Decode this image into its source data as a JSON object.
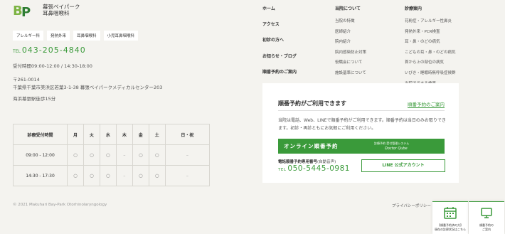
{
  "logo": {
    "mark_b": "B",
    "mark_p": "P",
    "line1": "幕張ベイパーク",
    "line2": "耳鼻咽喉科"
  },
  "chips": [
    "アレルギー科",
    "発熱外来",
    "耳鼻咽喉科",
    "小児耳鼻咽喉科"
  ],
  "contact": {
    "tel_label": "TEL",
    "tel": "043-205-4840",
    "hours": "受付時間09:00-12:00 / 14:30-18:00",
    "postal": "〒261-0014",
    "address": "千葉県千葉市美浜区若葉3-1-38 幕張ベイパークメディカルセンター203",
    "station": "海浜幕張駅徒歩15分"
  },
  "schedule": {
    "header": [
      "診療受付時間",
      "月",
      "火",
      "水",
      "木",
      "金",
      "土",
      "日・祝"
    ],
    "rows": [
      {
        "time": "09:00 - 12:00",
        "cells": [
          "○",
          "○",
          "○",
          "–",
          "○",
          "○",
          "–"
        ]
      },
      {
        "time": "14:30 - 17:30",
        "cells": [
          "○",
          "○",
          "○",
          "–",
          "○",
          "○",
          "–"
        ]
      }
    ]
  },
  "nav": {
    "main": [
      "ホーム",
      "アクセス",
      "初診の方へ",
      "お知らせ・ブログ",
      "順番予約のご案内"
    ],
    "about": {
      "title": "当院について",
      "items": [
        "当院の特徴",
        "医師紹介",
        "院内紹介",
        "院内感染防止対策",
        "役職会について",
        "施設基準について"
      ]
    },
    "medical": {
      "title": "診療案内",
      "items": [
        "花粉症・アレルギー性鼻炎",
        "発熱外来・PCR検査",
        "耳・鼻・のどの病気",
        "こどもの耳・鼻・のどの病気",
        "首から上の部位の病気",
        "いびき・睡眠時無呼吸症候群",
        "当院でできる検査"
      ]
    }
  },
  "reservation": {
    "title": "順番予約がご利用できます",
    "link": "順番予約のご案内",
    "desc": "当院は電話、Web、LINEで順番予約がご利用できます。順番予約は当日のみお取りできます。初診・再診ともにお気軽にご利用ください。",
    "banner_main": "オンライン順番予約",
    "banner_sub1": "診療予約 受付管理システム",
    "banner_sub2": "Doctor Qube",
    "tel_label": "電話順番予約専用番号",
    "tel_note": "(自動音声)",
    "tel_prefix": "TEL",
    "tel": "050-5445-0981",
    "line_btn": "LINE 公式アカウント"
  },
  "footer": {
    "copyright": "© 2021 Makuhari Bay-Park Otorhinolaryngology",
    "privacy": "プライバシーポリシー"
  },
  "floating": [
    {
      "icon": "calendar-icon",
      "line1": "【順番予約済の方】",
      "line2": "現在の診察状況はこちら"
    },
    {
      "icon": "monitor-icon",
      "line1": "順番予約の",
      "line2": "ご案内"
    }
  ],
  "colors": {
    "accent": "#3a9a3a",
    "background": "#f4f3ef"
  }
}
